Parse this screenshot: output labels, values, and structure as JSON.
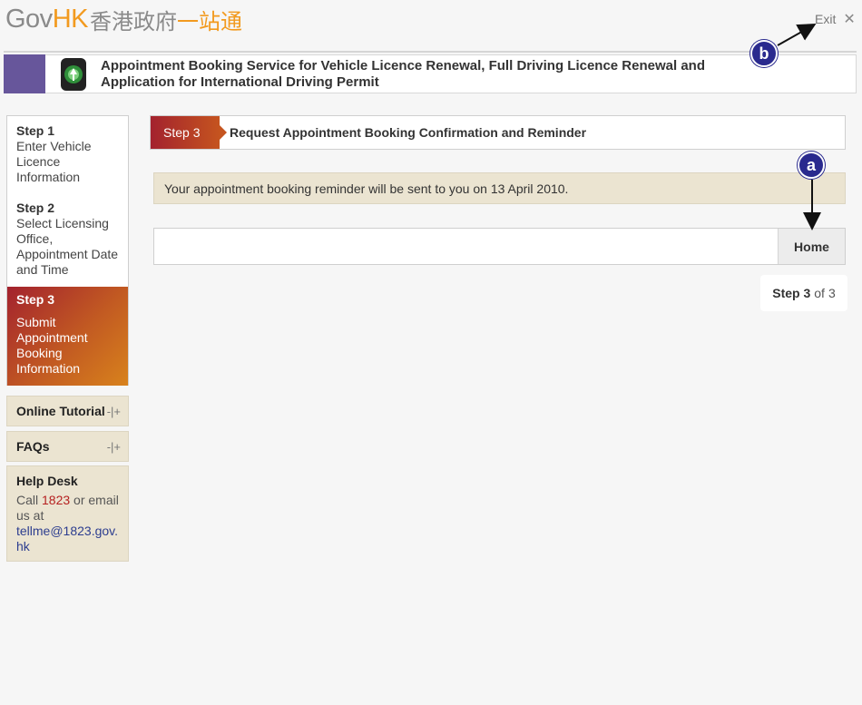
{
  "header": {
    "logo_gov": "Gov",
    "logo_hk": "HK",
    "logo_cn_grey": "香港政府",
    "logo_cn_orange": "一站通",
    "exit_label": "Exit",
    "exit_icon": "close-icon"
  },
  "banner": {
    "title_line1": "Appointment Booking Service for Vehicle Licence Renewal, Full Driving Licence Renewal and",
    "title_line2": "Application for International Driving Permit",
    "accent_color": "#67569b"
  },
  "annotations": {
    "a": "a",
    "b": "b"
  },
  "sidebar": {
    "steps": [
      {
        "num": "Step 1",
        "label": "Enter Vehicle Licence Information"
      },
      {
        "num": "Step 2",
        "label": "Select Licensing Office, Appointment Date and Time"
      },
      {
        "num": "Step 3",
        "label": "Submit Appointment Booking Information"
      }
    ],
    "links": [
      {
        "label": "Online Tutorial"
      },
      {
        "label": "FAQs"
      }
    ],
    "helpdesk": {
      "title": "Help Desk",
      "call": "Call ",
      "phone": "1823",
      "or": " or email us at",
      "email": "tellme@1823.gov.hk"
    }
  },
  "main": {
    "step_tag": "Step 3",
    "step_title": "Request Appointment Booking Confirmation and Reminder",
    "notice": "Your appointment booking reminder will be sent to you on 13 April 2010.",
    "home_button": "Home",
    "indicator": {
      "current": "Step 3",
      "of": "of",
      "total": "3"
    }
  },
  "colors": {
    "active_step_start": "#a3222e",
    "active_step_end": "#d8821c",
    "panel_beige": "#ebe4d1",
    "logo_orange": "#f29a1f"
  }
}
